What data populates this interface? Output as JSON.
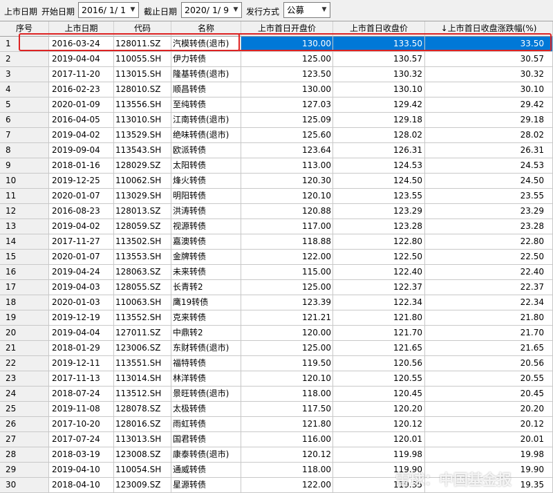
{
  "toolbar": {
    "listing_date_label": "上市日期",
    "start_date_label": "开始日期",
    "start_date_value": "2016/ 1/ 1",
    "end_date_label": "截止日期",
    "end_date_value": "2020/ 1/ 9",
    "issue_method_label": "发行方式",
    "issue_method_value": "公募"
  },
  "table": {
    "headers": [
      "序号",
      "上市日期",
      "代码",
      "名称",
      "上市首日开盘价",
      "上市首日收盘价",
      "↓上市首日收盘涨跌幅(%)"
    ],
    "selected_row": 0,
    "rows": [
      [
        "1",
        "2016-03-24",
        "128011.SZ",
        "汽模转债(退市)",
        "130.00",
        "133.50",
        "33.50"
      ],
      [
        "2",
        "2019-04-04",
        "110055.SH",
        "伊力转债",
        "125.00",
        "130.57",
        "30.57"
      ],
      [
        "3",
        "2017-11-20",
        "113015.SH",
        "隆基转债(退市)",
        "123.50",
        "130.32",
        "30.32"
      ],
      [
        "4",
        "2016-02-23",
        "128010.SZ",
        "顺昌转债",
        "130.00",
        "130.10",
        "30.10"
      ],
      [
        "5",
        "2020-01-09",
        "113556.SH",
        "至纯转债",
        "127.03",
        "129.42",
        "29.42"
      ],
      [
        "6",
        "2016-04-05",
        "113010.SH",
        "江南转债(退市)",
        "125.09",
        "129.18",
        "29.18"
      ],
      [
        "7",
        "2019-04-02",
        "113529.SH",
        "绝味转债(退市)",
        "125.60",
        "128.02",
        "28.02"
      ],
      [
        "8",
        "2019-09-04",
        "113543.SH",
        "欧派转债",
        "123.64",
        "126.31",
        "26.31"
      ],
      [
        "9",
        "2018-01-16",
        "128029.SZ",
        "太阳转债",
        "113.00",
        "124.53",
        "24.53"
      ],
      [
        "10",
        "2019-12-25",
        "110062.SH",
        "烽火转债",
        "120.30",
        "124.50",
        "24.50"
      ],
      [
        "11",
        "2020-01-07",
        "113029.SH",
        "明阳转债",
        "120.10",
        "123.55",
        "23.55"
      ],
      [
        "12",
        "2016-08-23",
        "128013.SZ",
        "洪涛转债",
        "120.88",
        "123.29",
        "23.29"
      ],
      [
        "13",
        "2019-04-02",
        "128059.SZ",
        "视源转债",
        "117.00",
        "123.28",
        "23.28"
      ],
      [
        "14",
        "2017-11-27",
        "113502.SH",
        "嘉澳转债",
        "118.88",
        "122.80",
        "22.80"
      ],
      [
        "15",
        "2020-01-07",
        "113553.SH",
        "金牌转债",
        "122.00",
        "122.50",
        "22.50"
      ],
      [
        "16",
        "2019-04-24",
        "128063.SZ",
        "未来转债",
        "115.00",
        "122.40",
        "22.40"
      ],
      [
        "17",
        "2019-04-03",
        "128055.SZ",
        "长青转2",
        "125.00",
        "122.37",
        "22.37"
      ],
      [
        "18",
        "2020-01-03",
        "110063.SH",
        "鹰19转债",
        "123.39",
        "122.34",
        "22.34"
      ],
      [
        "19",
        "2019-12-19",
        "113552.SH",
        "克来转债",
        "121.21",
        "121.80",
        "21.80"
      ],
      [
        "20",
        "2019-04-04",
        "127011.SZ",
        "中鼎转2",
        "120.00",
        "121.70",
        "21.70"
      ],
      [
        "21",
        "2018-01-29",
        "123006.SZ",
        "东财转债(退市)",
        "125.00",
        "121.65",
        "21.65"
      ],
      [
        "22",
        "2019-12-11",
        "113551.SH",
        "福特转债",
        "119.50",
        "120.56",
        "20.56"
      ],
      [
        "23",
        "2017-11-13",
        "113014.SH",
        "林洋转债",
        "120.10",
        "120.55",
        "20.55"
      ],
      [
        "24",
        "2018-07-24",
        "113512.SH",
        "景旺转债(退市)",
        "118.00",
        "120.45",
        "20.45"
      ],
      [
        "25",
        "2019-11-08",
        "128078.SZ",
        "太极转债",
        "117.50",
        "120.20",
        "20.20"
      ],
      [
        "26",
        "2017-10-20",
        "128016.SZ",
        "雨虹转债",
        "121.80",
        "120.12",
        "20.12"
      ],
      [
        "27",
        "2017-07-24",
        "113013.SH",
        "国君转债",
        "116.00",
        "120.01",
        "20.01"
      ],
      [
        "28",
        "2018-03-19",
        "123008.SZ",
        "康泰转债(退市)",
        "120.12",
        "119.98",
        "19.98"
      ],
      [
        "29",
        "2019-04-10",
        "110054.SH",
        "通威转债",
        "118.00",
        "119.90",
        "19.90"
      ],
      [
        "30",
        "2018-04-10",
        "123009.SZ",
        "星源转债",
        "122.00",
        "119.35",
        "19.35"
      ]
    ]
  },
  "watermark": "雪球：中国基金报",
  "colors": {
    "selection": "#0078d7",
    "highlight_border": "#d22"
  }
}
